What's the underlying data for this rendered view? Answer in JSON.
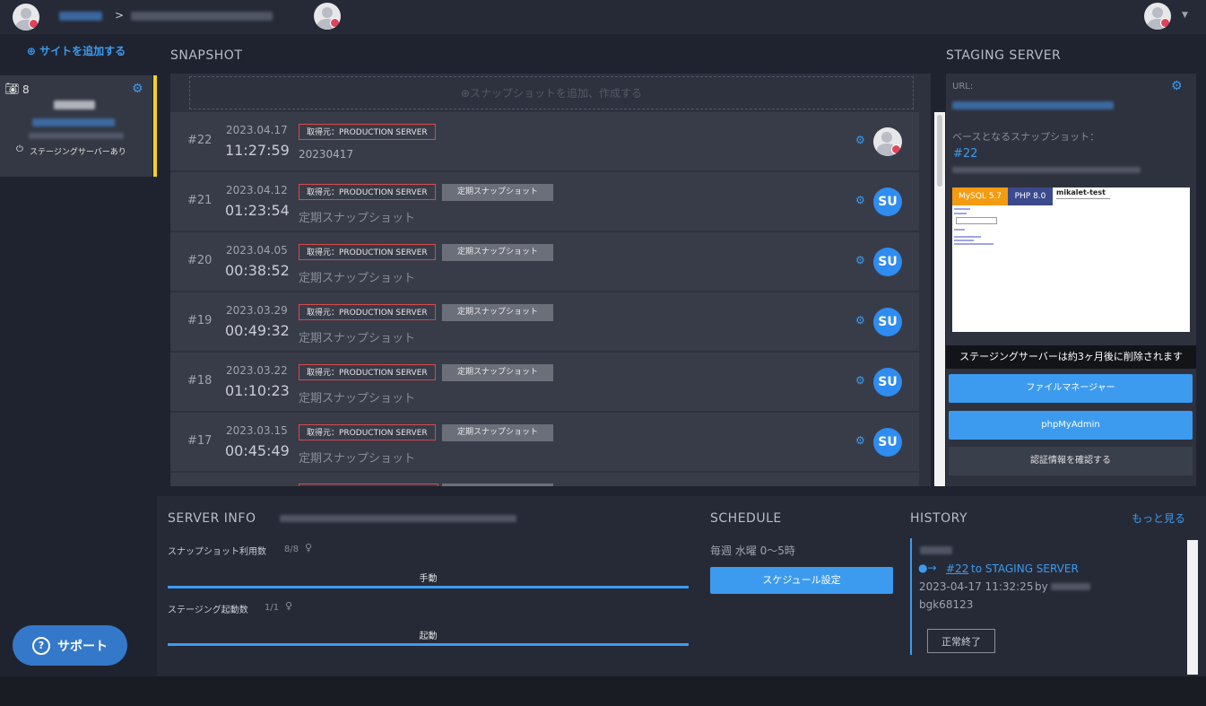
{
  "header": {
    "breadcrumb_sep": ">"
  },
  "sidebar": {
    "add_site_label": "サイトを追加する",
    "site": {
      "snapshot_count": "8",
      "staging_label": "ステージングサーバーあり"
    },
    "support_label": "サポート"
  },
  "snapshot": {
    "title": "SNAPSHOT",
    "add_label": "スナップショットを追加、作成する",
    "rows": [
      {
        "num": "#22",
        "date": "2023.04.17",
        "time": "11:27:59",
        "source": "取得元：PRODUCTION SERVER",
        "tag": "",
        "memo": "20230417"
      },
      {
        "num": "#21",
        "date": "2023.04.12",
        "time": "01:23:54",
        "source": "取得元：PRODUCTION SERVER",
        "tag": "定期スナップショット",
        "memo": "定期スナップショット"
      },
      {
        "num": "#20",
        "date": "2023.04.05",
        "time": "00:38:52",
        "source": "取得元：PRODUCTION SERVER",
        "tag": "定期スナップショット",
        "memo": "定期スナップショット"
      },
      {
        "num": "#19",
        "date": "2023.03.29",
        "time": "00:49:32",
        "source": "取得元：PRODUCTION SERVER",
        "tag": "定期スナップショット",
        "memo": "定期スナップショット"
      },
      {
        "num": "#18",
        "date": "2023.03.22",
        "time": "01:10:23",
        "source": "取得元：PRODUCTION SERVER",
        "tag": "定期スナップショット",
        "memo": "定期スナップショット"
      },
      {
        "num": "#17",
        "date": "2023.03.15",
        "time": "00:45:49",
        "source": "取得元：PRODUCTION SERVER",
        "tag": "定期スナップショット",
        "memo": "定期スナップショット"
      }
    ],
    "action_label": "SU"
  },
  "staging": {
    "title": "STAGING SERVER",
    "url_label": "URL:",
    "base_label": "ベースとなるスナップショット：",
    "base_num": "#22",
    "preview_title": "mikalet-test",
    "mysql_badge": "MySQL 5.7",
    "php_badge": "PHP 8.0",
    "delete_note": "ステージングサーバーは約3ヶ月後に削除されます",
    "file_manager_label": "ファイルマネージャー",
    "phpmyadmin_label": "phpMyAdmin",
    "auth_label": "認証情報を確認する"
  },
  "server_info": {
    "title": "SERVER INFO",
    "snapshot_usage_label": "スナップショット利用数",
    "snapshot_usage_value": "8/8",
    "snapshot_usage_fraction": 1,
    "manual_label": "手動",
    "staging_usage_label": "ステージング起動数",
    "staging_usage_value": "1/1",
    "staging_usage_fraction": 1,
    "start_label": "起動"
  },
  "schedule": {
    "title": "SCHEDULE",
    "text": "毎週 水曜 0～5時",
    "button_label": "スケジュール設定"
  },
  "history": {
    "title": "HISTORY",
    "more_label": "もっと見る",
    "entry": {
      "link": "#22",
      "target": "to STAGING SERVER",
      "datetime": "2023-04-17 11:32:25",
      "by": "by",
      "user": "bgk68123",
      "status": "正常終了"
    }
  }
}
